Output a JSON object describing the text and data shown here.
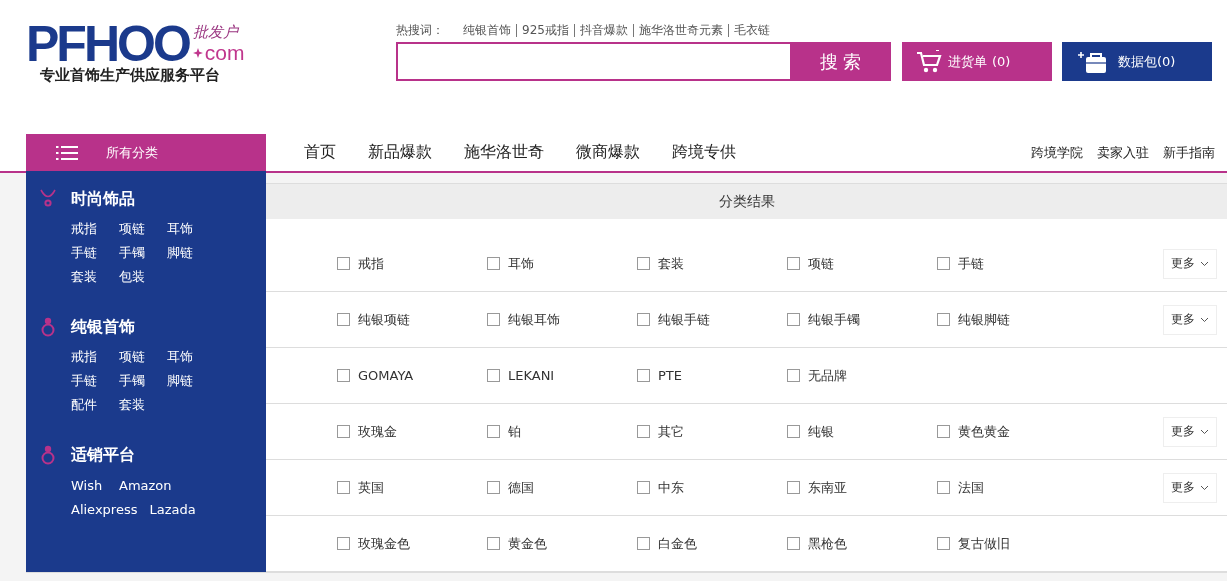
{
  "logo": {
    "wordmark": "PFHOO",
    "script": "批发户",
    "domain": "com",
    "tagline": "专业首饰生产供应服务平台"
  },
  "hot_search": {
    "label": "热搜词：",
    "terms": [
      "纯银首饰",
      "925戒指",
      "抖音爆款",
      "施华洛世奇元素",
      "毛衣链"
    ]
  },
  "search": {
    "button": "搜 索"
  },
  "cart_button": {
    "label": "进货单",
    "count": "(0)"
  },
  "data_pack_button": {
    "label": "数据包(0)"
  },
  "category_menu": {
    "title": "所有分类",
    "sections": [
      {
        "kind": "necklace",
        "title": "时尚饰品",
        "rows": [
          [
            "戒指",
            "项链",
            "耳饰"
          ],
          [
            "手链",
            "手镯",
            "脚链"
          ],
          [
            "套装",
            "包装"
          ]
        ]
      },
      {
        "kind": "ring",
        "title": "纯银首饰",
        "rows": [
          [
            "戒指",
            "项链",
            "耳饰"
          ],
          [
            "手链",
            "手镯",
            "脚链"
          ],
          [
            "配件",
            "套装"
          ]
        ]
      },
      {
        "kind": "ring",
        "title": "适销平台",
        "rows": [
          [
            "Wish",
            "Amazon"
          ],
          [
            "Aliexpress",
            "Lazada"
          ]
        ]
      }
    ]
  },
  "nav": {
    "items": [
      "首页",
      "新品爆款",
      "施华洛世奇",
      "微商爆款",
      "跨境专供"
    ],
    "links": [
      "跨境学院",
      "卖家入驻",
      "新手指南"
    ]
  },
  "results": {
    "title": "分类结果",
    "rows": [
      {
        "options": [
          {
            "text": "戒指",
            "checked": false
          },
          {
            "text": "耳饰",
            "checked": false
          },
          {
            "text": "套装",
            "checked": false
          },
          {
            "text": "项链",
            "checked": false
          },
          {
            "text": "手链",
            "checked": false
          }
        ],
        "more": "更多"
      },
      {
        "options": [
          {
            "text": "纯银项链",
            "checked": false
          },
          {
            "text": "纯银耳饰",
            "checked": false
          },
          {
            "text": "纯银手链",
            "checked": false
          },
          {
            "text": "纯银手镯",
            "checked": false
          },
          {
            "text": "纯银脚链",
            "checked": false
          }
        ],
        "more": "更多"
      },
      {
        "options": [
          {
            "text": "GOMAYA",
            "checked": false
          },
          {
            "text": "LEKANI",
            "checked": false
          },
          {
            "text": "PTE",
            "checked": false
          },
          {
            "text": "无品牌",
            "checked": false
          }
        ]
      },
      {
        "options": [
          {
            "text": "玫瑰金",
            "checked": false
          },
          {
            "text": "铂",
            "checked": false
          },
          {
            "text": "其它",
            "checked": false
          },
          {
            "text": "纯银",
            "checked": false
          },
          {
            "text": "黄色黄金",
            "checked": false
          }
        ],
        "more": "更多"
      },
      {
        "options": [
          {
            "text": "英国",
            "checked": false
          },
          {
            "text": "德国",
            "checked": false
          },
          {
            "text": "中东",
            "checked": false
          },
          {
            "text": "东南亚",
            "checked": false
          },
          {
            "text": "法国",
            "checked": false
          }
        ],
        "more": "更多"
      },
      {
        "options": [
          {
            "text": "玫瑰金色",
            "checked": false
          },
          {
            "text": "黄金色",
            "checked": false
          },
          {
            "text": "白金色",
            "checked": false
          },
          {
            "text": "黑枪色",
            "checked": false
          },
          {
            "text": "复古做旧",
            "checked": false
          }
        ]
      }
    ]
  }
}
